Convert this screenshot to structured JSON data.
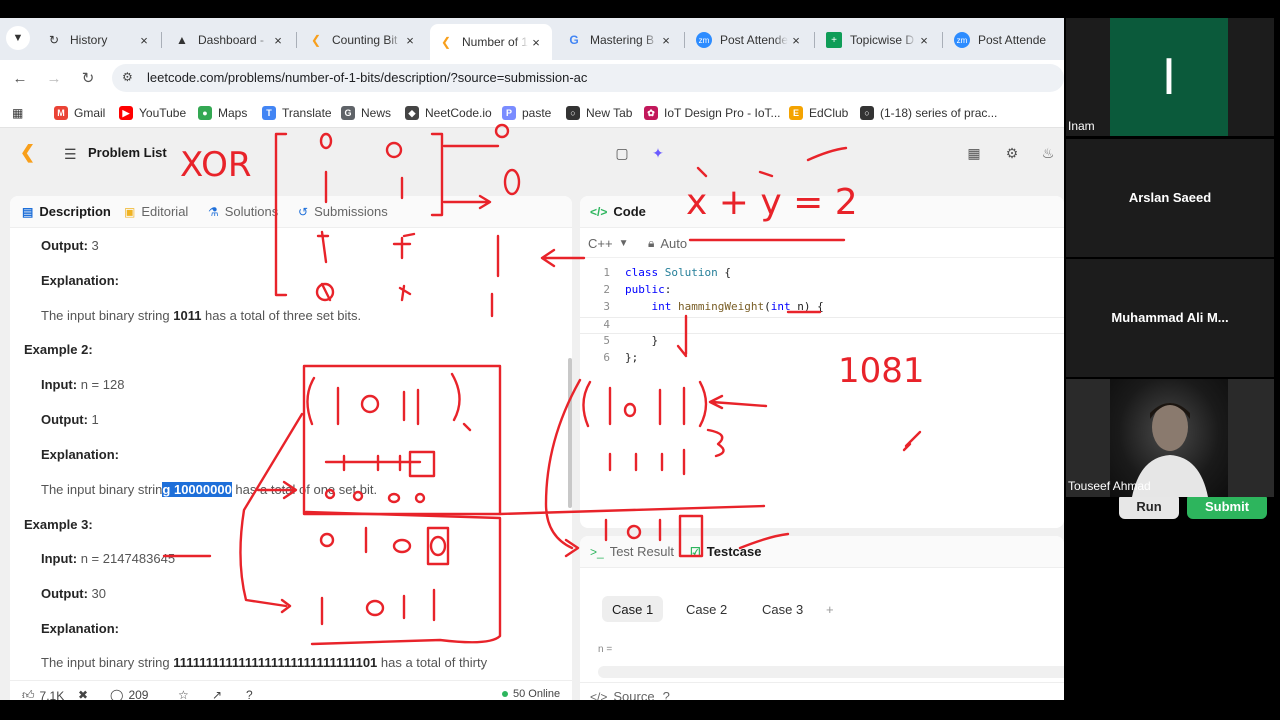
{
  "browser": {
    "tabs": [
      {
        "label": "History",
        "icon": "history-icon"
      },
      {
        "label": "Dashboard -",
        "icon": "dashboard-icon"
      },
      {
        "label": "Counting Bit",
        "icon": "leetcode-icon"
      },
      {
        "label": "Number of 1",
        "icon": "leetcode-icon",
        "active": true
      },
      {
        "label": "Mastering B",
        "icon": "google-icon"
      },
      {
        "label": "Post Attende",
        "icon": "zoom-icon"
      },
      {
        "label": "Topicwise D",
        "icon": "sheets-icon"
      },
      {
        "label": "Post Attende",
        "icon": "zoom-icon"
      }
    ],
    "close_glyph": "×",
    "url": "leetcode.com/problems/number-of-1-bits/description/?source=submission-ac",
    "bookmarks": [
      {
        "label": "Gmail",
        "color": "#ea4335"
      },
      {
        "label": "YouTube",
        "color": "#ff0000"
      },
      {
        "label": "Maps",
        "color": "#34a853"
      },
      {
        "label": "Translate",
        "color": "#4285f4"
      },
      {
        "label": "News",
        "color": "#5f6368"
      },
      {
        "label": "NeetCode.io",
        "color": "#444444"
      },
      {
        "label": "paste",
        "color": "#7a8cff"
      },
      {
        "label": "New Tab",
        "color": "#333333"
      },
      {
        "label": "IoT Design Pro - IoT...",
        "color": "#c2185b"
      },
      {
        "label": "EdClub",
        "color": "#f4a300"
      },
      {
        "label": "(1-18) series of prac...",
        "color": "#333333"
      }
    ]
  },
  "leetcode": {
    "problem_list": "Problem List",
    "desc_tabs": [
      "Description",
      "Editorial",
      "Solutions",
      "Submissions"
    ],
    "description": {
      "ex1_output_label": "Output:",
      "ex1_output_value": "3",
      "ex1_explanation_label": "Explanation:",
      "ex1_explanation_pre": "The input binary string ",
      "ex1_explanation_bold": "1011",
      "ex1_explanation_post": " has a total of three set bits.",
      "ex2_title": "Example 2:",
      "ex2_input_label": "Input:",
      "ex2_input_value": "n = 128",
      "ex2_output_label": "Output:",
      "ex2_output_value": "1",
      "ex2_explanation_label": "Explanation:",
      "ex2_explanation_pre": "The input binary strin",
      "ex2_explanation_hl": "g 10000000",
      "ex2_explanation_post": " has a total of one set bit.",
      "ex3_title": "Example 3:",
      "ex3_input_label": "Input:",
      "ex3_input_value": "n = 2147483645",
      "ex3_output_label": "Output:",
      "ex3_output_value": "30",
      "ex3_explanation_label": "Explanation:",
      "ex3_explanation_pre": "The input binary string ",
      "ex3_explanation_bold": "1111111111111111111111111111101",
      "ex3_explanation_post": " has a total of thirty"
    },
    "footer": {
      "likes": "7.1K",
      "comments": "209",
      "online": "50 Online"
    },
    "code": {
      "title": "Code",
      "language": "C++",
      "mode": "Auto",
      "lines": [
        {
          "n": "1",
          "text": "class Solution {"
        },
        {
          "n": "2",
          "text": "public:"
        },
        {
          "n": "3",
          "text": "    int hammingWeight(int n) {"
        },
        {
          "n": "4",
          "text": ""
        },
        {
          "n": "5",
          "text": "    }"
        },
        {
          "n": "6",
          "text": "};"
        }
      ]
    },
    "testcase": {
      "result_tab": "Test Result",
      "testcase_tab": "Testcase",
      "cases": [
        "Case 1",
        "Case 2",
        "Case 3"
      ],
      "add": "+",
      "input_label": "n =",
      "source": "Source"
    },
    "run": "Run",
    "submit": "Submit"
  },
  "participants": [
    {
      "name": "Inam",
      "initial": "I",
      "avatar_color": "#0b5a3b"
    },
    {
      "name": "Arslan Saeed"
    },
    {
      "name": "Muhammad Ali M..."
    },
    {
      "name": "Touseef Ahmad"
    }
  ],
  "annotations": {
    "xor": "XOR",
    "equation": "x + y = 2",
    "number": "1081"
  },
  "colors": {
    "ink": "#e8232a",
    "accent_green": "#2db55d",
    "highlight": "#1e6fd9"
  }
}
